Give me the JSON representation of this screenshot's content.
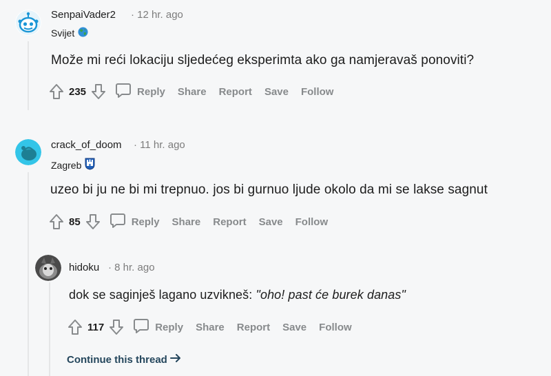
{
  "comments": [
    {
      "username": "SenpaiVader2",
      "time": "· 12 hr. ago",
      "flair": "Svijet",
      "flair_icon": "globe-icon",
      "body": "Može mi reći lokaciju sljedećeg eksperimta ako ga namjeravaš ponoviti?",
      "score": "235"
    },
    {
      "username": "crack_of_doom",
      "time": "· 11 hr. ago",
      "flair": "Zagreb",
      "flair_icon": "zagreb-coat-of-arms-icon",
      "body": "uzeo bi ju ne bi mi trepnuo. jos bi gurnuo ljude okolo da mi se lakse sagnut",
      "score": "85"
    },
    {
      "username": "hidoku",
      "time": "· 8 hr. ago",
      "body_prefix": "dok se saginješ lagano uzvikneš: ",
      "body_quote": "\"oho! past će burek danas\"",
      "score": "117"
    }
  ],
  "actions": {
    "reply": "Reply",
    "share": "Share",
    "report": "Report",
    "save": "Save",
    "follow": "Follow"
  },
  "continue_thread": "Continue this thread",
  "colors": {
    "background": "#f6f7f8",
    "action_gray": "#878a8c",
    "link_blue": "#24465c",
    "thread_line": "#e5e6e7"
  }
}
